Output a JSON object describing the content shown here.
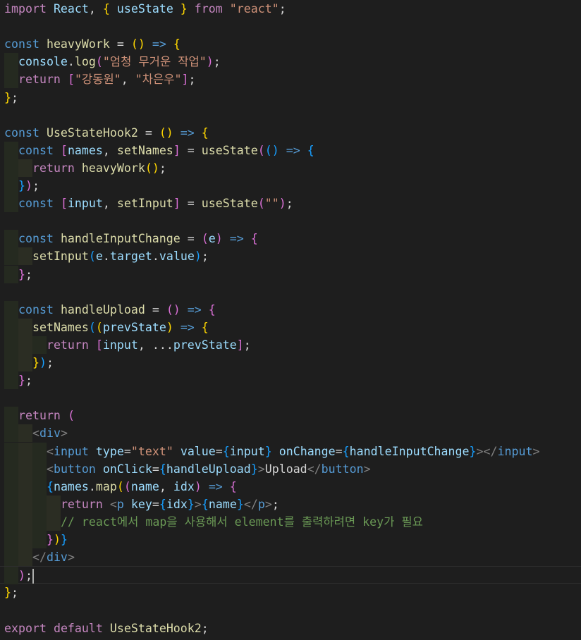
{
  "editor": {
    "language": "javascript-react",
    "lines": [
      {
        "tokens": [
          [
            "import",
            "ctl"
          ],
          [
            " React",
            "var"
          ],
          [
            ", ",
            "pun"
          ],
          [
            "{",
            "b1"
          ],
          [
            " useState ",
            "var"
          ],
          [
            "}",
            "b1"
          ],
          [
            " from ",
            "ctl"
          ],
          [
            "\"react\"",
            "str"
          ],
          [
            ";",
            "pun"
          ]
        ]
      },
      {
        "tokens": []
      },
      {
        "tokens": [
          [
            "const",
            "kw"
          ],
          [
            " ",
            "pun"
          ],
          [
            "heavyWork",
            "fn"
          ],
          [
            " = ",
            "pun"
          ],
          [
            "()",
            "b1"
          ],
          [
            " => ",
            "kw"
          ],
          [
            "{",
            "b1"
          ]
        ]
      },
      {
        "tokens": [
          [
            "  ",
            "pun"
          ],
          [
            "console",
            "var"
          ],
          [
            ".",
            "pun"
          ],
          [
            "log",
            "fn"
          ],
          [
            "(",
            "b2"
          ],
          [
            "\"엄청 무거운 작업\"",
            "str"
          ],
          [
            ")",
            "b2"
          ],
          [
            ";",
            "pun"
          ]
        ]
      },
      {
        "tokens": [
          [
            "  ",
            "pun"
          ],
          [
            "return",
            "ctl"
          ],
          [
            " ",
            "pun"
          ],
          [
            "[",
            "b2"
          ],
          [
            "\"강동원\"",
            "str"
          ],
          [
            ", ",
            "pun"
          ],
          [
            "\"차은우\"",
            "str"
          ],
          [
            "]",
            "b2"
          ],
          [
            ";",
            "pun"
          ]
        ]
      },
      {
        "tokens": [
          [
            "}",
            "b1"
          ],
          [
            ";",
            "pun"
          ]
        ]
      },
      {
        "tokens": []
      },
      {
        "tokens": [
          [
            "const",
            "kw"
          ],
          [
            " ",
            "pun"
          ],
          [
            "UseStateHook2",
            "fn"
          ],
          [
            " = ",
            "pun"
          ],
          [
            "()",
            "b1"
          ],
          [
            " => ",
            "kw"
          ],
          [
            "{",
            "b1"
          ]
        ]
      },
      {
        "tokens": [
          [
            "  ",
            "pun"
          ],
          [
            "const",
            "kw"
          ],
          [
            " ",
            "pun"
          ],
          [
            "[",
            "b2"
          ],
          [
            "names",
            "var"
          ],
          [
            ", ",
            "pun"
          ],
          [
            "setNames",
            "fn"
          ],
          [
            "]",
            "b2"
          ],
          [
            " = ",
            "pun"
          ],
          [
            "useState",
            "fn"
          ],
          [
            "(",
            "b2"
          ],
          [
            "()",
            "b3"
          ],
          [
            " => ",
            "kw"
          ],
          [
            "{",
            "b3"
          ]
        ]
      },
      {
        "tokens": [
          [
            "    ",
            "pun"
          ],
          [
            "return",
            "ctl"
          ],
          [
            " ",
            "pun"
          ],
          [
            "heavyWork",
            "fn"
          ],
          [
            "()",
            "b1"
          ],
          [
            ";",
            "pun"
          ]
        ]
      },
      {
        "tokens": [
          [
            "  ",
            "pun"
          ],
          [
            "}",
            "b3"
          ],
          [
            ")",
            "b2"
          ],
          [
            ";",
            "pun"
          ]
        ]
      },
      {
        "tokens": [
          [
            "  ",
            "pun"
          ],
          [
            "const",
            "kw"
          ],
          [
            " ",
            "pun"
          ],
          [
            "[",
            "b2"
          ],
          [
            "input",
            "var"
          ],
          [
            ", ",
            "pun"
          ],
          [
            "setInput",
            "fn"
          ],
          [
            "]",
            "b2"
          ],
          [
            " = ",
            "pun"
          ],
          [
            "useState",
            "fn"
          ],
          [
            "(",
            "b2"
          ],
          [
            "\"\"",
            "str"
          ],
          [
            ")",
            "b2"
          ],
          [
            ";",
            "pun"
          ]
        ]
      },
      {
        "tokens": []
      },
      {
        "tokens": [
          [
            "  ",
            "pun"
          ],
          [
            "const",
            "kw"
          ],
          [
            " ",
            "pun"
          ],
          [
            "handleInputChange",
            "fn"
          ],
          [
            " = ",
            "pun"
          ],
          [
            "(",
            "b2"
          ],
          [
            "e",
            "var"
          ],
          [
            ")",
            "b2"
          ],
          [
            " => ",
            "kw"
          ],
          [
            "{",
            "b2"
          ]
        ]
      },
      {
        "tokens": [
          [
            "    ",
            "pun"
          ],
          [
            "setInput",
            "fn"
          ],
          [
            "(",
            "b3"
          ],
          [
            "e",
            "var"
          ],
          [
            ".",
            "pun"
          ],
          [
            "target",
            "var"
          ],
          [
            ".",
            "pun"
          ],
          [
            "value",
            "var"
          ],
          [
            ")",
            "b3"
          ],
          [
            ";",
            "pun"
          ]
        ]
      },
      {
        "tokens": [
          [
            "  ",
            "pun"
          ],
          [
            "}",
            "b2"
          ],
          [
            ";",
            "pun"
          ]
        ]
      },
      {
        "tokens": []
      },
      {
        "tokens": [
          [
            "  ",
            "pun"
          ],
          [
            "const",
            "kw"
          ],
          [
            " ",
            "pun"
          ],
          [
            "handleUpload",
            "fn"
          ],
          [
            " = ",
            "pun"
          ],
          [
            "()",
            "b2"
          ],
          [
            " => ",
            "kw"
          ],
          [
            "{",
            "b2"
          ]
        ]
      },
      {
        "tokens": [
          [
            "    ",
            "pun"
          ],
          [
            "setNames",
            "fn"
          ],
          [
            "(",
            "b3"
          ],
          [
            "(",
            "b1"
          ],
          [
            "prevState",
            "var"
          ],
          [
            ")",
            "b1"
          ],
          [
            " => ",
            "kw"
          ],
          [
            "{",
            "b1"
          ]
        ]
      },
      {
        "tokens": [
          [
            "      ",
            "pun"
          ],
          [
            "return",
            "ctl"
          ],
          [
            " ",
            "pun"
          ],
          [
            "[",
            "b2"
          ],
          [
            "input",
            "var"
          ],
          [
            ", ...",
            "pun"
          ],
          [
            "prevState",
            "var"
          ],
          [
            "]",
            "b2"
          ],
          [
            ";",
            "pun"
          ]
        ]
      },
      {
        "tokens": [
          [
            "    ",
            "pun"
          ],
          [
            "}",
            "b1"
          ],
          [
            ")",
            "b3"
          ],
          [
            ";",
            "pun"
          ]
        ]
      },
      {
        "tokens": [
          [
            "  ",
            "pun"
          ],
          [
            "}",
            "b2"
          ],
          [
            ";",
            "pun"
          ]
        ]
      },
      {
        "tokens": []
      },
      {
        "tokens": [
          [
            "  ",
            "pun"
          ],
          [
            "return",
            "ctl"
          ],
          [
            " ",
            "pun"
          ],
          [
            "(",
            "b2"
          ]
        ]
      },
      {
        "tokens": [
          [
            "    ",
            "pun"
          ],
          [
            "<",
            "tag"
          ],
          [
            "div",
            "tagname"
          ],
          [
            ">",
            "tag"
          ]
        ]
      },
      {
        "tokens": [
          [
            "      ",
            "pun"
          ],
          [
            "<",
            "tag"
          ],
          [
            "input",
            "tagname"
          ],
          [
            " ",
            "pun"
          ],
          [
            "type",
            "attr"
          ],
          [
            "=",
            "pun"
          ],
          [
            "\"text\"",
            "str"
          ],
          [
            " ",
            "pun"
          ],
          [
            "value",
            "attr"
          ],
          [
            "=",
            "pun"
          ],
          [
            "{",
            "b3"
          ],
          [
            "input",
            "var"
          ],
          [
            "}",
            "b3"
          ],
          [
            " ",
            "pun"
          ],
          [
            "onChange",
            "attr"
          ],
          [
            "=",
            "pun"
          ],
          [
            "{",
            "b3"
          ],
          [
            "handleInputChange",
            "var"
          ],
          [
            "}",
            "b3"
          ],
          [
            "></",
            "tag"
          ],
          [
            "input",
            "tagname"
          ],
          [
            ">",
            "tag"
          ]
        ]
      },
      {
        "tokens": [
          [
            "      ",
            "pun"
          ],
          [
            "<",
            "tag"
          ],
          [
            "button",
            "tagname"
          ],
          [
            " ",
            "pun"
          ],
          [
            "onClick",
            "attr"
          ],
          [
            "=",
            "pun"
          ],
          [
            "{",
            "b3"
          ],
          [
            "handleUpload",
            "var"
          ],
          [
            "}",
            "b3"
          ],
          [
            ">",
            "tag"
          ],
          [
            "Upload",
            "jsx"
          ],
          [
            "</",
            "tag"
          ],
          [
            "button",
            "tagname"
          ],
          [
            ">",
            "tag"
          ]
        ]
      },
      {
        "tokens": [
          [
            "      ",
            "pun"
          ],
          [
            "{",
            "b3"
          ],
          [
            "names",
            "var"
          ],
          [
            ".",
            "pun"
          ],
          [
            "map",
            "fn"
          ],
          [
            "(",
            "b1"
          ],
          [
            "(",
            "b2"
          ],
          [
            "name",
            "var"
          ],
          [
            ", ",
            "pun"
          ],
          [
            "idx",
            "var"
          ],
          [
            ")",
            "b2"
          ],
          [
            " => ",
            "kw"
          ],
          [
            "{",
            "b2"
          ]
        ]
      },
      {
        "tokens": [
          [
            "        ",
            "pun"
          ],
          [
            "return",
            "ctl"
          ],
          [
            " ",
            "pun"
          ],
          [
            "<",
            "tag"
          ],
          [
            "p",
            "tagname"
          ],
          [
            " ",
            "pun"
          ],
          [
            "key",
            "attr"
          ],
          [
            "=",
            "pun"
          ],
          [
            "{",
            "b3"
          ],
          [
            "idx",
            "var"
          ],
          [
            "}",
            "b3"
          ],
          [
            ">",
            "tag"
          ],
          [
            "{",
            "b3"
          ],
          [
            "name",
            "var"
          ],
          [
            "}",
            "b3"
          ],
          [
            "</",
            "tag"
          ],
          [
            "p",
            "tagname"
          ],
          [
            ">",
            "tag"
          ],
          [
            ";",
            "pun"
          ]
        ]
      },
      {
        "tokens": [
          [
            "        ",
            "pun"
          ],
          [
            "// react에서 map을 사용해서 element를 출력하려면 key가 필요",
            "com"
          ]
        ]
      },
      {
        "tokens": [
          [
            "      ",
            "pun"
          ],
          [
            "}",
            "b2"
          ],
          [
            ")",
            "b1"
          ],
          [
            "}",
            "b3"
          ]
        ]
      },
      {
        "tokens": [
          [
            "    ",
            "pun"
          ],
          [
            "</",
            "tag"
          ],
          [
            "div",
            "tagname"
          ],
          [
            ">",
            "tag"
          ]
        ]
      },
      {
        "tokens": [
          [
            "  ",
            "pun"
          ],
          [
            ")",
            "b2"
          ],
          [
            ";",
            "pun"
          ]
        ],
        "cursor": true
      },
      {
        "tokens": [
          [
            "}",
            "b1"
          ],
          [
            ";",
            "pun"
          ]
        ]
      },
      {
        "tokens": []
      },
      {
        "tokens": [
          [
            "export",
            "ctl"
          ],
          [
            " ",
            "pun"
          ],
          [
            "default",
            "ctl"
          ],
          [
            " ",
            "pun"
          ],
          [
            "UseStateHook2",
            "def"
          ],
          [
            ";",
            "pun"
          ]
        ]
      }
    ]
  },
  "colors": {
    "background": "#1e1e1e",
    "keyword": "#569cd6",
    "control": "#c586c0",
    "function": "#dcdcaa",
    "variable": "#9cdcfe",
    "string": "#ce9178",
    "comment": "#6a9955",
    "bracket_gold": "#ffd700",
    "bracket_orchid": "#da70d6",
    "bracket_blue": "#179fff"
  }
}
